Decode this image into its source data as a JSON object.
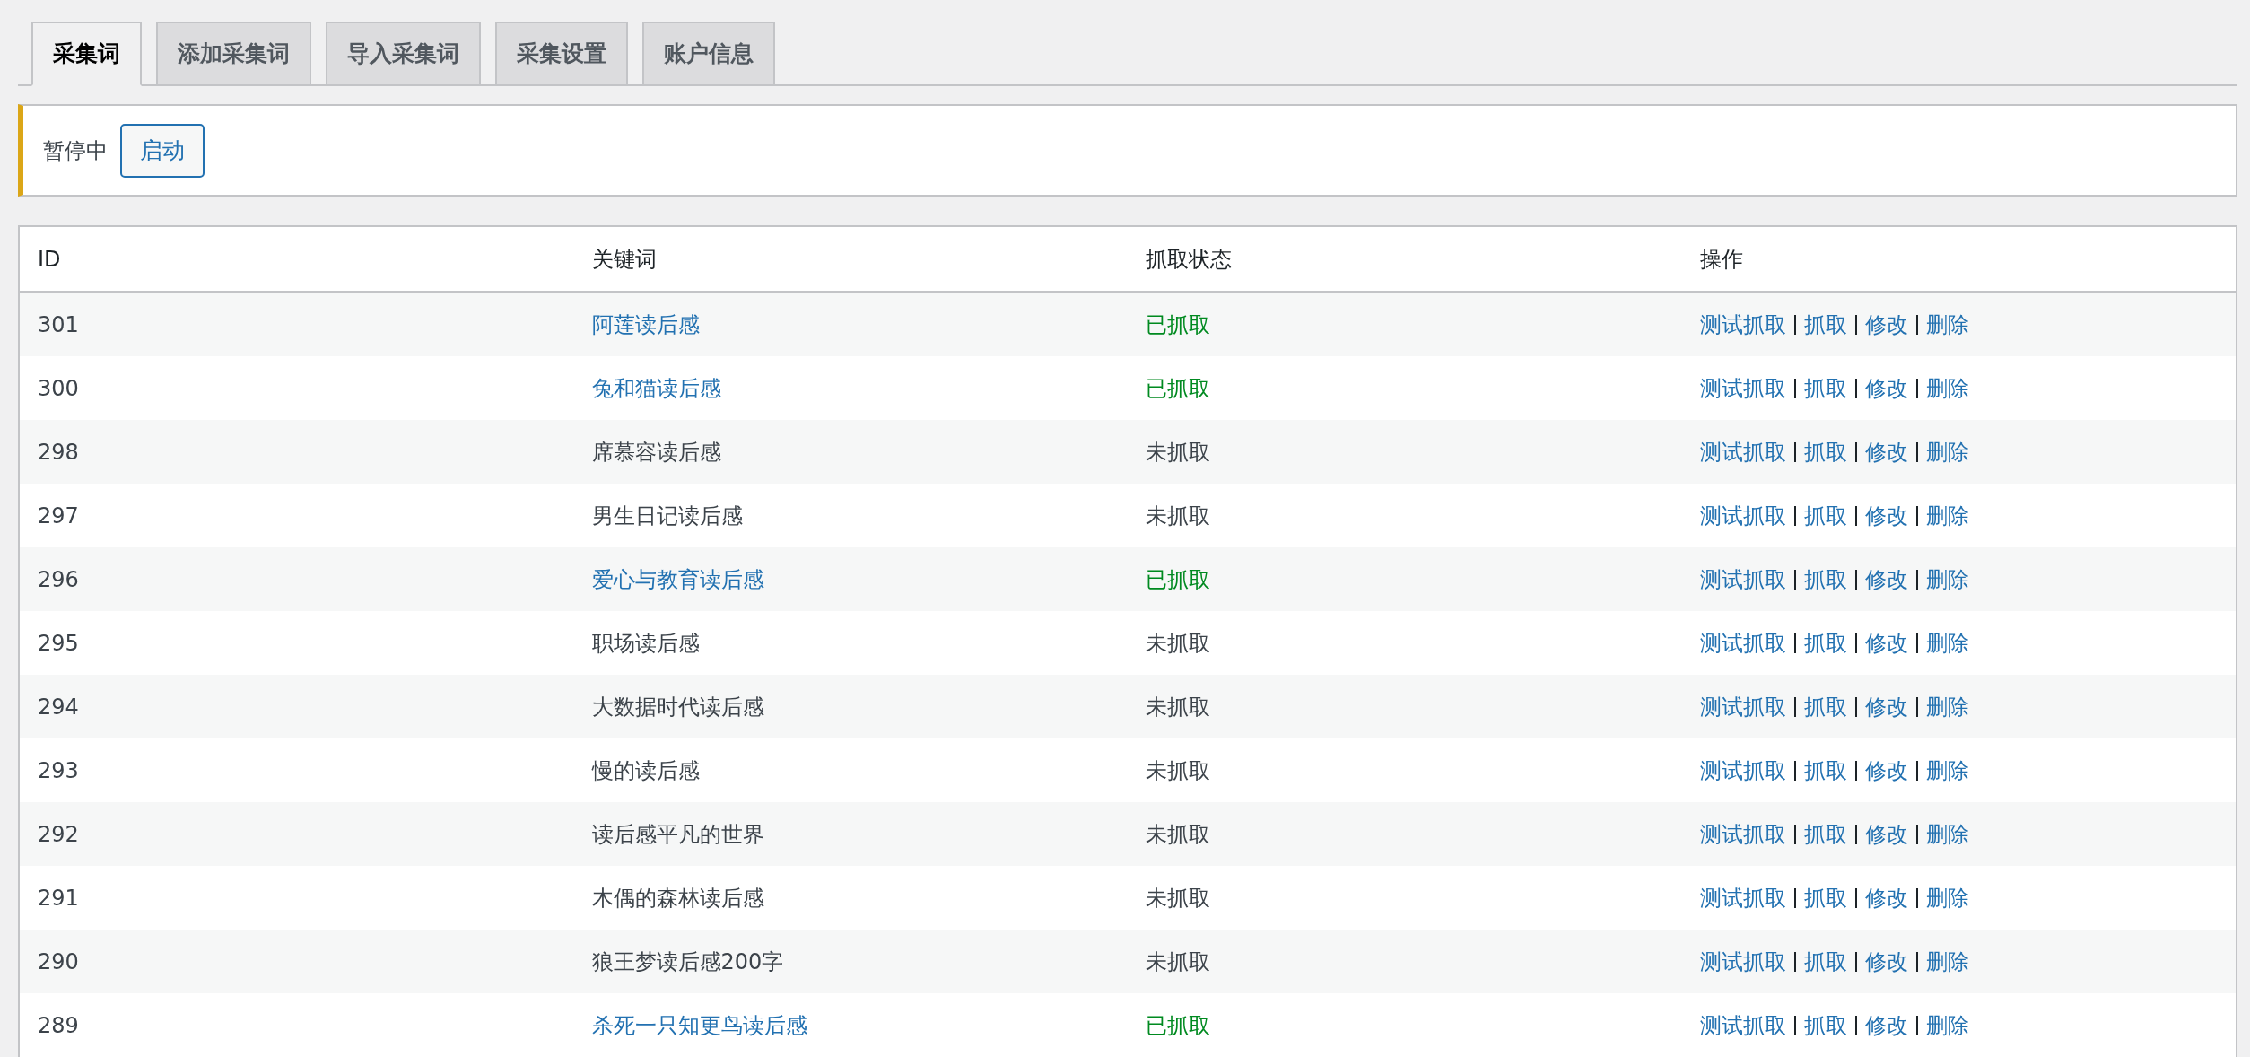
{
  "tabs": [
    {
      "label": "采集词",
      "selected": true
    },
    {
      "label": "添加采集词",
      "selected": false
    },
    {
      "label": "导入采集词",
      "selected": false
    },
    {
      "label": "采集设置",
      "selected": false
    },
    {
      "label": "账户信息",
      "selected": false
    }
  ],
  "notice": {
    "status": "暂停中",
    "button": "启动"
  },
  "table": {
    "columns": [
      "ID",
      "关键词",
      "抓取状态",
      "操作"
    ],
    "rows": [
      {
        "id": "301",
        "keyword": "阿莲读后感",
        "fetched": true,
        "status": "已抓取",
        "actions": [
          "测试抓取",
          "抓取",
          "修改",
          "删除"
        ]
      },
      {
        "id": "300",
        "keyword": "兔和猫读后感",
        "fetched": true,
        "status": "已抓取",
        "actions": [
          "测试抓取",
          "抓取",
          "修改",
          "删除"
        ]
      },
      {
        "id": "298",
        "keyword": "席慕容读后感",
        "fetched": false,
        "status": "未抓取",
        "actions": [
          "测试抓取",
          "抓取",
          "修改",
          "删除"
        ]
      },
      {
        "id": "297",
        "keyword": "男生日记读后感",
        "fetched": false,
        "status": "未抓取",
        "actions": [
          "测试抓取",
          "抓取",
          "修改",
          "删除"
        ]
      },
      {
        "id": "296",
        "keyword": "爱心与教育读后感",
        "fetched": true,
        "status": "已抓取",
        "actions": [
          "测试抓取",
          "抓取",
          "修改",
          "删除"
        ]
      },
      {
        "id": "295",
        "keyword": "职场读后感",
        "fetched": false,
        "status": "未抓取",
        "actions": [
          "测试抓取",
          "抓取",
          "修改",
          "删除"
        ]
      },
      {
        "id": "294",
        "keyword": "大数据时代读后感",
        "fetched": false,
        "status": "未抓取",
        "actions": [
          "测试抓取",
          "抓取",
          "修改",
          "删除"
        ]
      },
      {
        "id": "293",
        "keyword": "慢的读后感",
        "fetched": false,
        "status": "未抓取",
        "actions": [
          "测试抓取",
          "抓取",
          "修改",
          "删除"
        ]
      },
      {
        "id": "292",
        "keyword": "读后感平凡的世界",
        "fetched": false,
        "status": "未抓取",
        "actions": [
          "测试抓取",
          "抓取",
          "修改",
          "删除"
        ]
      },
      {
        "id": "291",
        "keyword": "木偶的森林读后感",
        "fetched": false,
        "status": "未抓取",
        "actions": [
          "测试抓取",
          "抓取",
          "修改",
          "删除"
        ]
      },
      {
        "id": "290",
        "keyword": "狼王梦读后感200字",
        "fetched": false,
        "status": "未抓取",
        "actions": [
          "测试抓取",
          "抓取",
          "修改",
          "删除"
        ]
      },
      {
        "id": "289",
        "keyword": "杀死一只知更鸟读后感",
        "fetched": true,
        "status": "已抓取",
        "actions": [
          "测试抓取",
          "抓取",
          "修改",
          "删除"
        ]
      }
    ]
  }
}
